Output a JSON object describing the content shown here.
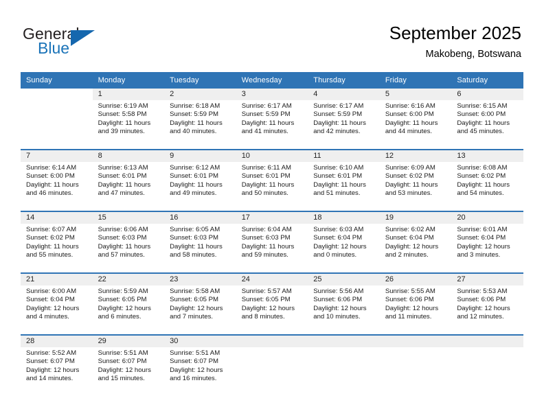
{
  "brand": {
    "name_part1": "General",
    "name_part2": "Blue",
    "triangle_color": "#1567ae",
    "blue_color": "#1a73b8"
  },
  "header": {
    "title": "September 2025",
    "location": "Makobeng, Botswana"
  },
  "theme": {
    "header_blue": "#2f74b5",
    "daynum_band": "#efefef",
    "text": "#1a1a1a"
  },
  "weekday_headers": [
    "Sunday",
    "Monday",
    "Tuesday",
    "Wednesday",
    "Thursday",
    "Friday",
    "Saturday"
  ],
  "labels": {
    "sunrise": "Sunrise:",
    "sunset": "Sunset:",
    "daylight": "Daylight:"
  },
  "weeks": [
    [
      {
        "day": "",
        "blank": true
      },
      {
        "day": "1",
        "sunrise": "Sunrise: 6:19 AM",
        "sunset": "Sunset: 5:58 PM",
        "daylight": "Daylight: 11 hours and 39 minutes."
      },
      {
        "day": "2",
        "sunrise": "Sunrise: 6:18 AM",
        "sunset": "Sunset: 5:59 PM",
        "daylight": "Daylight: 11 hours and 40 minutes."
      },
      {
        "day": "3",
        "sunrise": "Sunrise: 6:17 AM",
        "sunset": "Sunset: 5:59 PM",
        "daylight": "Daylight: 11 hours and 41 minutes."
      },
      {
        "day": "4",
        "sunrise": "Sunrise: 6:17 AM",
        "sunset": "Sunset: 5:59 PM",
        "daylight": "Daylight: 11 hours and 42 minutes."
      },
      {
        "day": "5",
        "sunrise": "Sunrise: 6:16 AM",
        "sunset": "Sunset: 6:00 PM",
        "daylight": "Daylight: 11 hours and 44 minutes."
      },
      {
        "day": "6",
        "sunrise": "Sunrise: 6:15 AM",
        "sunset": "Sunset: 6:00 PM",
        "daylight": "Daylight: 11 hours and 45 minutes."
      }
    ],
    [
      {
        "day": "7",
        "sunrise": "Sunrise: 6:14 AM",
        "sunset": "Sunset: 6:00 PM",
        "daylight": "Daylight: 11 hours and 46 minutes."
      },
      {
        "day": "8",
        "sunrise": "Sunrise: 6:13 AM",
        "sunset": "Sunset: 6:01 PM",
        "daylight": "Daylight: 11 hours and 47 minutes."
      },
      {
        "day": "9",
        "sunrise": "Sunrise: 6:12 AM",
        "sunset": "Sunset: 6:01 PM",
        "daylight": "Daylight: 11 hours and 49 minutes."
      },
      {
        "day": "10",
        "sunrise": "Sunrise: 6:11 AM",
        "sunset": "Sunset: 6:01 PM",
        "daylight": "Daylight: 11 hours and 50 minutes."
      },
      {
        "day": "11",
        "sunrise": "Sunrise: 6:10 AM",
        "sunset": "Sunset: 6:01 PM",
        "daylight": "Daylight: 11 hours and 51 minutes."
      },
      {
        "day": "12",
        "sunrise": "Sunrise: 6:09 AM",
        "sunset": "Sunset: 6:02 PM",
        "daylight": "Daylight: 11 hours and 53 minutes."
      },
      {
        "day": "13",
        "sunrise": "Sunrise: 6:08 AM",
        "sunset": "Sunset: 6:02 PM",
        "daylight": "Daylight: 11 hours and 54 minutes."
      }
    ],
    [
      {
        "day": "14",
        "sunrise": "Sunrise: 6:07 AM",
        "sunset": "Sunset: 6:02 PM",
        "daylight": "Daylight: 11 hours and 55 minutes."
      },
      {
        "day": "15",
        "sunrise": "Sunrise: 6:06 AM",
        "sunset": "Sunset: 6:03 PM",
        "daylight": "Daylight: 11 hours and 57 minutes."
      },
      {
        "day": "16",
        "sunrise": "Sunrise: 6:05 AM",
        "sunset": "Sunset: 6:03 PM",
        "daylight": "Daylight: 11 hours and 58 minutes."
      },
      {
        "day": "17",
        "sunrise": "Sunrise: 6:04 AM",
        "sunset": "Sunset: 6:03 PM",
        "daylight": "Daylight: 11 hours and 59 minutes."
      },
      {
        "day": "18",
        "sunrise": "Sunrise: 6:03 AM",
        "sunset": "Sunset: 6:04 PM",
        "daylight": "Daylight: 12 hours and 0 minutes."
      },
      {
        "day": "19",
        "sunrise": "Sunrise: 6:02 AM",
        "sunset": "Sunset: 6:04 PM",
        "daylight": "Daylight: 12 hours and 2 minutes."
      },
      {
        "day": "20",
        "sunrise": "Sunrise: 6:01 AM",
        "sunset": "Sunset: 6:04 PM",
        "daylight": "Daylight: 12 hours and 3 minutes."
      }
    ],
    [
      {
        "day": "21",
        "sunrise": "Sunrise: 6:00 AM",
        "sunset": "Sunset: 6:04 PM",
        "daylight": "Daylight: 12 hours and 4 minutes."
      },
      {
        "day": "22",
        "sunrise": "Sunrise: 5:59 AM",
        "sunset": "Sunset: 6:05 PM",
        "daylight": "Daylight: 12 hours and 6 minutes."
      },
      {
        "day": "23",
        "sunrise": "Sunrise: 5:58 AM",
        "sunset": "Sunset: 6:05 PM",
        "daylight": "Daylight: 12 hours and 7 minutes."
      },
      {
        "day": "24",
        "sunrise": "Sunrise: 5:57 AM",
        "sunset": "Sunset: 6:05 PM",
        "daylight": "Daylight: 12 hours and 8 minutes."
      },
      {
        "day": "25",
        "sunrise": "Sunrise: 5:56 AM",
        "sunset": "Sunset: 6:06 PM",
        "daylight": "Daylight: 12 hours and 10 minutes."
      },
      {
        "day": "26",
        "sunrise": "Sunrise: 5:55 AM",
        "sunset": "Sunset: 6:06 PM",
        "daylight": "Daylight: 12 hours and 11 minutes."
      },
      {
        "day": "27",
        "sunrise": "Sunrise: 5:53 AM",
        "sunset": "Sunset: 6:06 PM",
        "daylight": "Daylight: 12 hours and 12 minutes."
      }
    ],
    [
      {
        "day": "28",
        "sunrise": "Sunrise: 5:52 AM",
        "sunset": "Sunset: 6:07 PM",
        "daylight": "Daylight: 12 hours and 14 minutes."
      },
      {
        "day": "29",
        "sunrise": "Sunrise: 5:51 AM",
        "sunset": "Sunset: 6:07 PM",
        "daylight": "Daylight: 12 hours and 15 minutes."
      },
      {
        "day": "30",
        "sunrise": "Sunrise: 5:51 AM",
        "sunset": "Sunset: 6:07 PM",
        "daylight": "Daylight: 12 hours and 16 minutes."
      },
      {
        "day": "",
        "empty": true
      },
      {
        "day": "",
        "empty": true
      },
      {
        "day": "",
        "empty": true
      },
      {
        "day": "",
        "empty": true
      }
    ]
  ]
}
